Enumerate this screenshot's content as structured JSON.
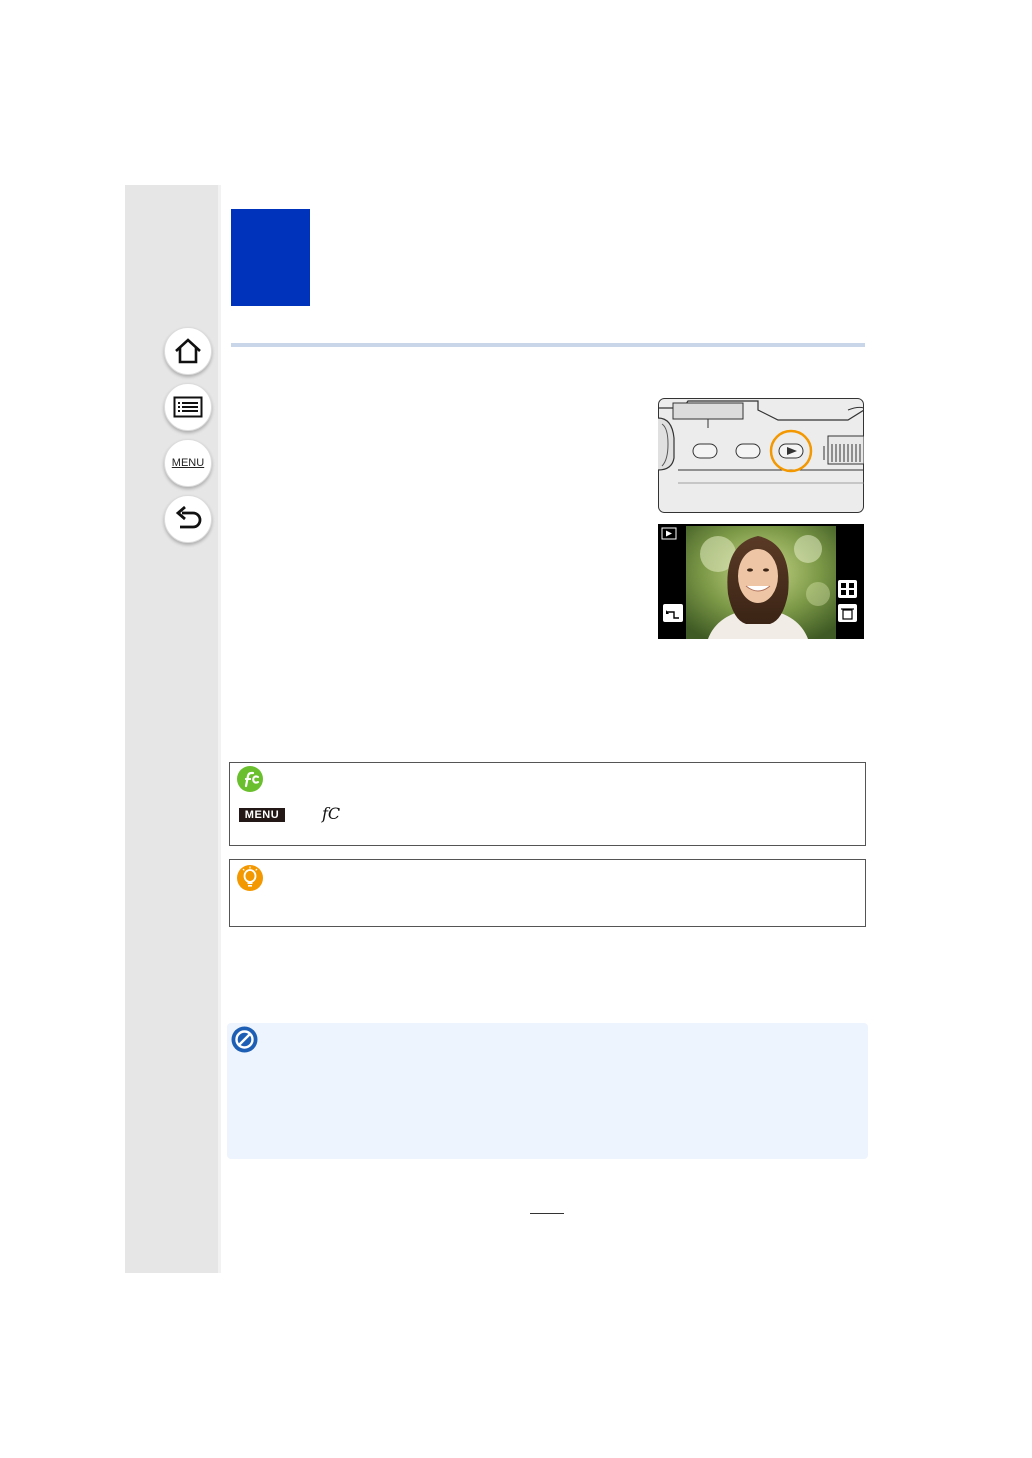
{
  "sidebar": {
    "items": [
      {
        "name": "home",
        "icon": "home-icon"
      },
      {
        "name": "contents",
        "icon": "list-icon"
      },
      {
        "name": "menu",
        "icon": "menu-icon",
        "label": "MENU"
      },
      {
        "name": "back",
        "icon": "back-arrow-icon"
      }
    ]
  },
  "colors": {
    "chapter_block": "#0033bb",
    "sidebar_bg": "#e6e6e6",
    "rule": "#c9d6ea",
    "custom_icon": "#6abf2e",
    "tip_icon": "#f39800",
    "note_icon": "#1d5fb4",
    "note_bg": "#eef4fd",
    "highlight_ring": "#f39800"
  },
  "custom_box": {
    "icon": "custom-wrench-icon",
    "menu_label": "MENU",
    "custom_glyph": "𝑓C"
  },
  "tip_box": {
    "icon": "lightbulb-icon"
  },
  "note_box": {
    "icon": "not-available-icon"
  },
  "images": {
    "camera_top": {
      "icon": "playback-button-icon"
    },
    "screen": {
      "icons": [
        "playback-mode-icon",
        "thumbnail-view-icon",
        "delete-icon",
        "return-icon"
      ]
    }
  }
}
